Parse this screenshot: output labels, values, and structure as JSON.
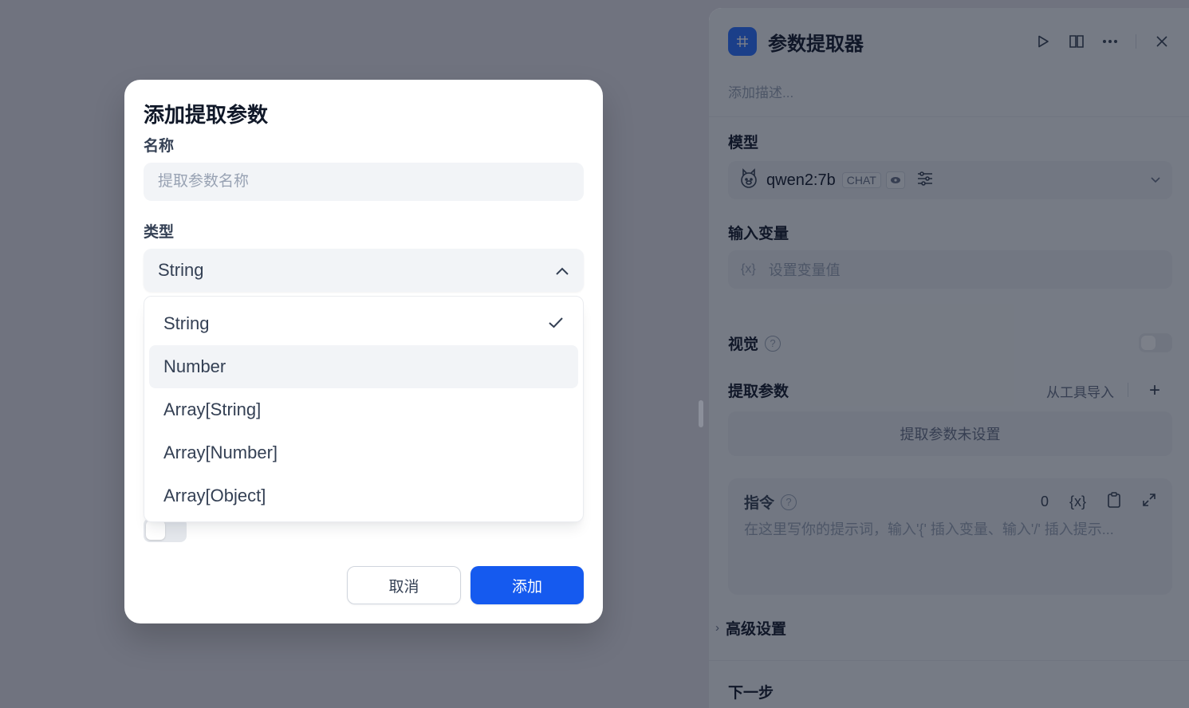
{
  "panel": {
    "title": "参数提取器",
    "description_placeholder": "添加描述...",
    "model_label": "模型",
    "model": {
      "name": "qwen2:7b",
      "mode_chip": "CHAT"
    },
    "input_var_label": "输入变量",
    "input_var_placeholder": "设置变量值",
    "input_var_icon_text": "{x}",
    "vision_label": "视觉",
    "vision_enabled": false,
    "extract_label": "提取参数",
    "import_from_tool": "从工具导入",
    "extract_empty": "提取参数未设置",
    "instruction_label": "指令",
    "instruction_count": "0",
    "instruction_var_icon_text": "{x}",
    "instruction_placeholder": "在这里写你的提示词，输入'{' 插入变量、输入'/' 插入提示...",
    "advanced_label": "高级设置",
    "next_step_label": "下一步"
  },
  "modal": {
    "title": "添加提取参数",
    "name_label": "名称",
    "name_placeholder": "提取参数名称",
    "name_value": "",
    "type_label": "类型",
    "type_selected": "String",
    "required_enabled": false,
    "cancel_label": "取消",
    "add_label": "添加"
  },
  "dropdown": {
    "options": [
      "String",
      "Number",
      "Array[String]",
      "Array[Number]",
      "Array[Object]"
    ],
    "selected": "String",
    "hovered": "Number"
  },
  "colors": {
    "primary": "#155aef",
    "node_icon": "#2970ff",
    "backdrop": "#70737f"
  }
}
